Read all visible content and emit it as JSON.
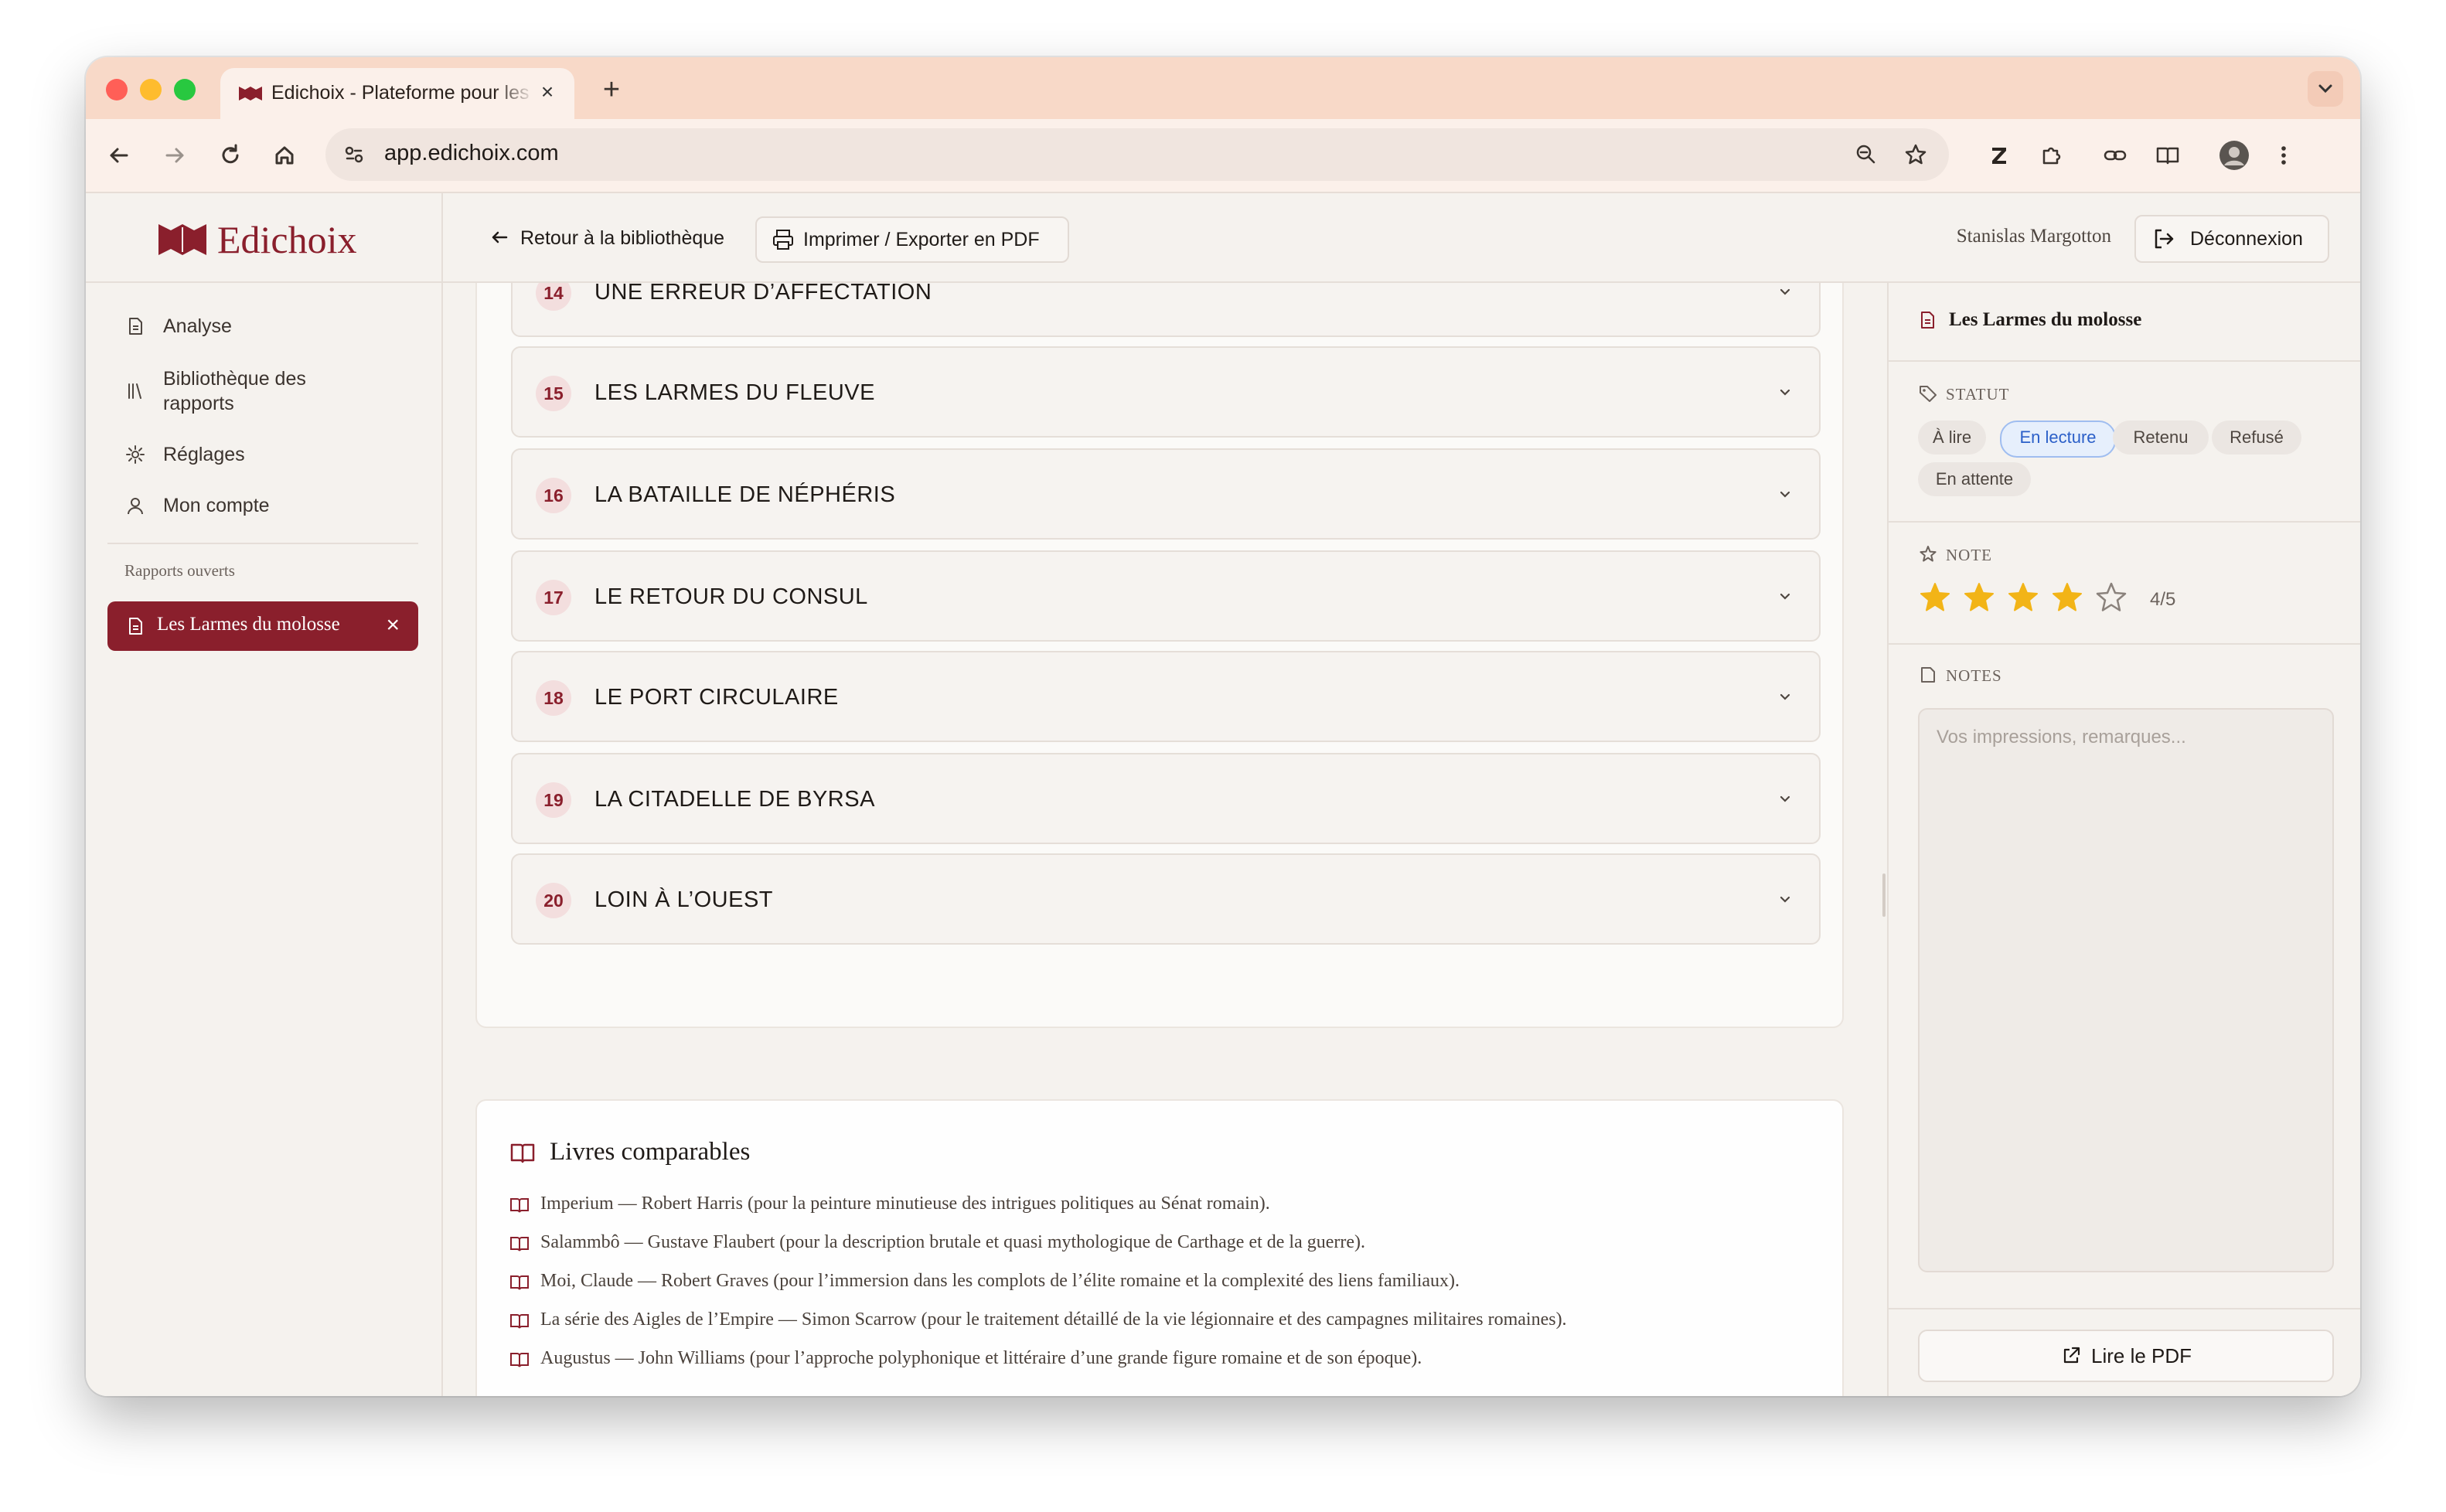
{
  "browser": {
    "tab_title": "Edichoix - Plateforme pour les éditeurs",
    "url": "app.edichoix.com"
  },
  "sidebar": {
    "brand": "Edichoix",
    "nav": [
      {
        "label": "Analyse",
        "icon": "document-icon"
      },
      {
        "label": "Bibliothèque des rapports",
        "icon": "library-icon"
      },
      {
        "label": "Réglages",
        "icon": "gear-icon"
      },
      {
        "label": "Mon compte",
        "icon": "user-icon"
      }
    ],
    "open_reports_title": "Rapports ouverts",
    "open_reports": [
      {
        "label": "Les Larmes du molosse",
        "active": true
      }
    ]
  },
  "header": {
    "back_label": "Retour à la bibliothèque",
    "print_label": "Imprimer / Exporter en PDF",
    "user_name": "Stanislas Margotton",
    "logout_label": "Déconnexion"
  },
  "chapters": [
    {
      "num": "14",
      "title": "UNE ERREUR D’AFFECTATION"
    },
    {
      "num": "15",
      "title": "LES LARMES DU FLEUVE"
    },
    {
      "num": "16",
      "title": "LA BATAILLE DE NÉPHÉRIS"
    },
    {
      "num": "17",
      "title": "LE RETOUR DU CONSUL"
    },
    {
      "num": "18",
      "title": "LE PORT CIRCULAIRE"
    },
    {
      "num": "19",
      "title": "LA CITADELLE DE BYRSA"
    },
    {
      "num": "20",
      "title": "LOIN À L’OUEST"
    }
  ],
  "comparables": {
    "title": "Livres comparables",
    "items": [
      "Imperium — Robert Harris (pour la peinture minutieuse des intrigues politiques au Sénat romain).",
      "Salammbô — Gustave Flaubert (pour la description brutale et quasi mythologique de Carthage et de la guerre).",
      "Moi, Claude — Robert Graves (pour l’immersion dans les complots de l’élite romaine et la complexité des liens familiaux).",
      "La série des Aigles de l’Empire — Simon Scarrow (pour le traitement détaillé de la vie légionnaire et des campagnes militaires romaines).",
      "Augustus — John Williams (pour l’approche polyphonique et littéraire d’une grande figure romaine et de son époque)."
    ]
  },
  "right_panel": {
    "report_title": "Les Larmes du molosse",
    "status_heading": "STATUT",
    "statuses": [
      {
        "label": "À lire",
        "active": false
      },
      {
        "label": "En lecture",
        "active": true
      },
      {
        "label": "Retenu",
        "active": false
      },
      {
        "label": "Refusé",
        "active": false
      },
      {
        "label": "En attente",
        "active": false
      }
    ],
    "rating_heading": "NOTE",
    "rating": 4,
    "rating_max": 5,
    "rating_label": "4/5",
    "notes_heading": "NOTES",
    "notes_placeholder": "Vos impressions, remarques...",
    "pdf_label": "Lire le PDF"
  },
  "colors": {
    "brand": "#8a1f2c",
    "star": "#f2b417",
    "active_chip": "#2b5fc8",
    "tabbar": "#f8d9c8"
  }
}
